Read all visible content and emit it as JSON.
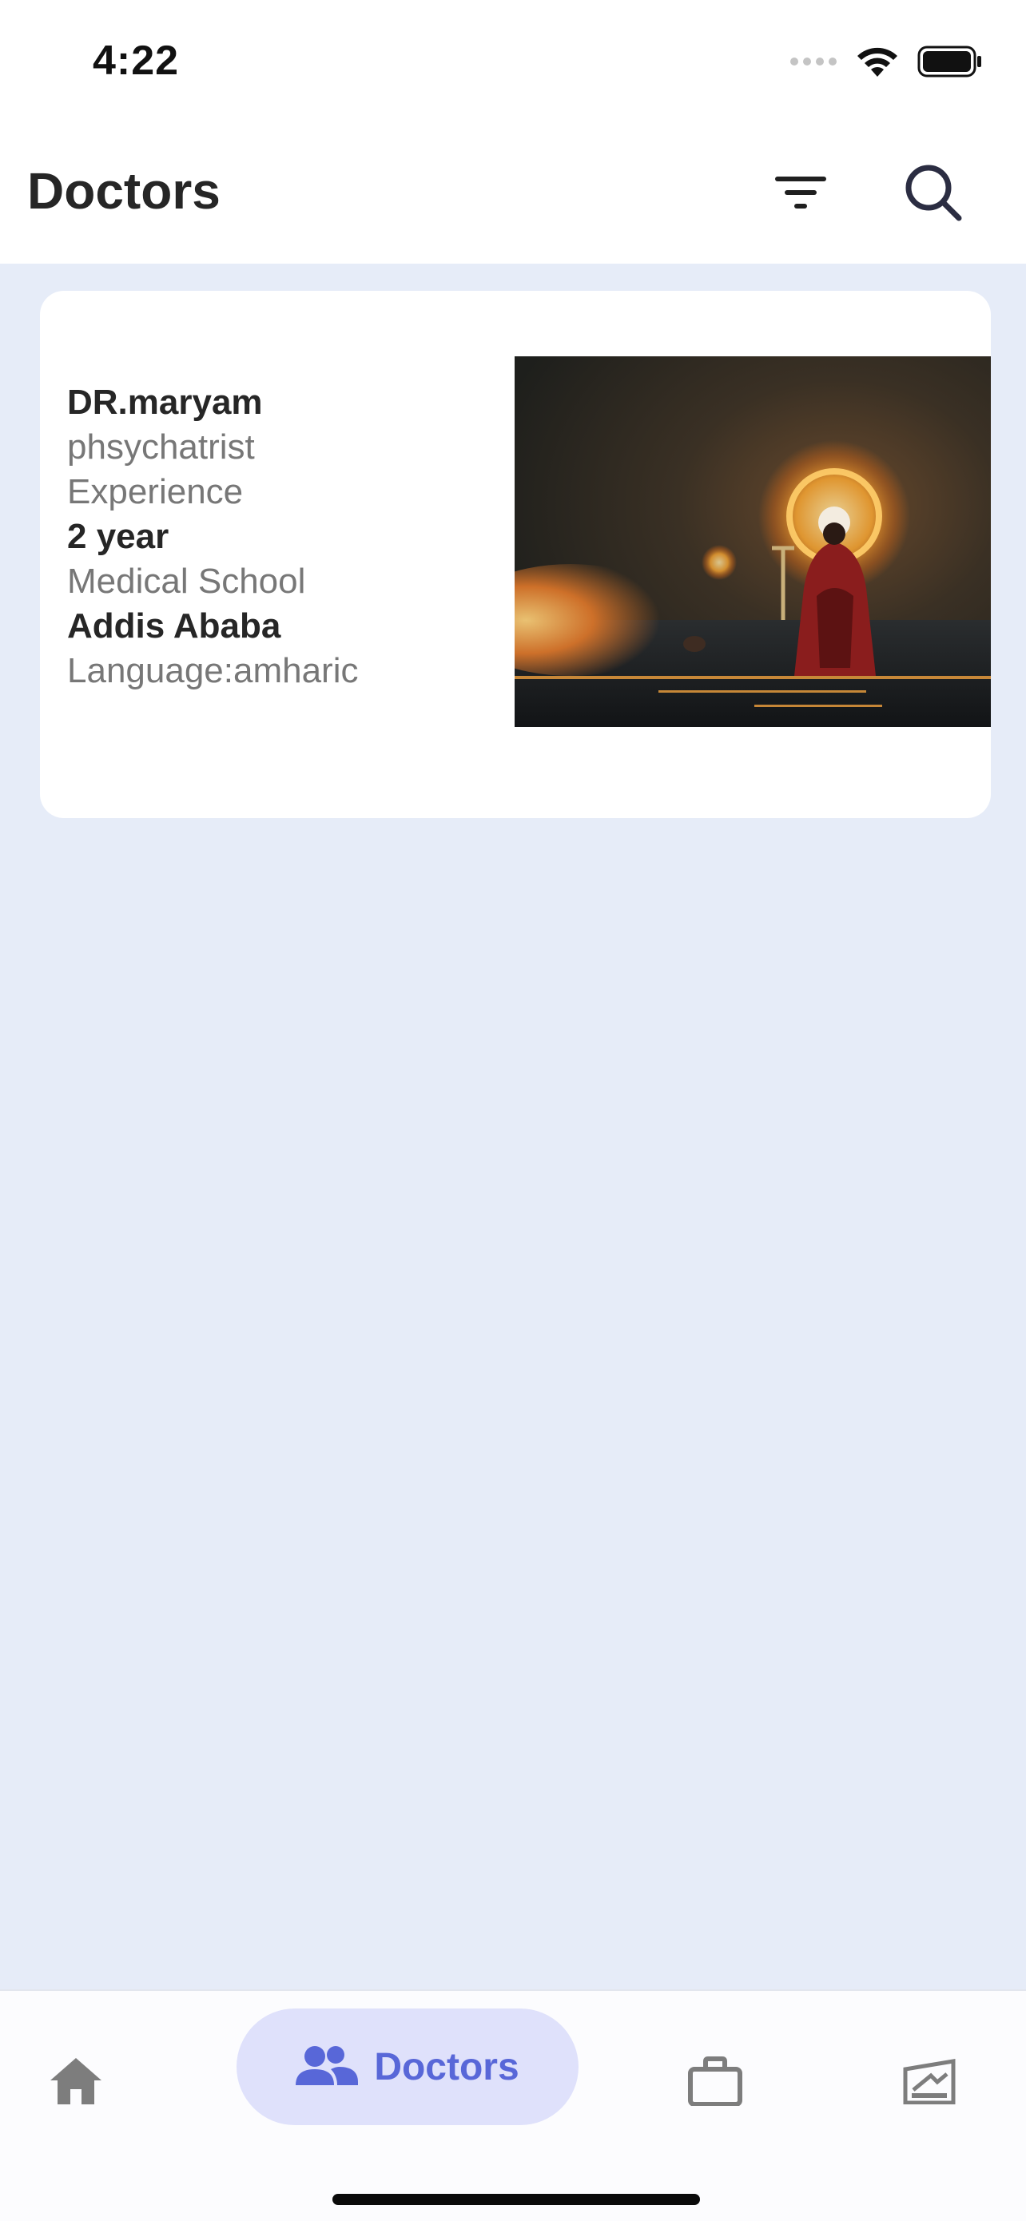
{
  "status_bar": {
    "time": "4:22",
    "icons": [
      "signal-icon",
      "wifi-icon",
      "battery-icon"
    ]
  },
  "header": {
    "title": "Doctors",
    "actions": [
      "filter-icon",
      "search-icon"
    ]
  },
  "doctors": [
    {
      "name": "DR.maryam",
      "specialty": "phsychatrist",
      "experience_label": "Experience",
      "experience_value": "2 year",
      "school_label": "Medical School",
      "school_value": "Addis Ababa",
      "language": "Language:amharic"
    }
  ],
  "bottom_nav": {
    "items": [
      {
        "icon": "home-icon",
        "label": ""
      },
      {
        "icon": "people-icon",
        "label": "Doctors"
      },
      {
        "icon": "briefcase-icon",
        "label": ""
      },
      {
        "icon": "presentation-icon",
        "label": ""
      }
    ],
    "active": "Doctors"
  },
  "colors": {
    "background": "#e6ecf8",
    "card": "#ffffff",
    "accent": "#5867d8",
    "accent_pill": "#dfe1fb",
    "muted_text": "#777777",
    "icon_gray": "#7d7d7d"
  }
}
